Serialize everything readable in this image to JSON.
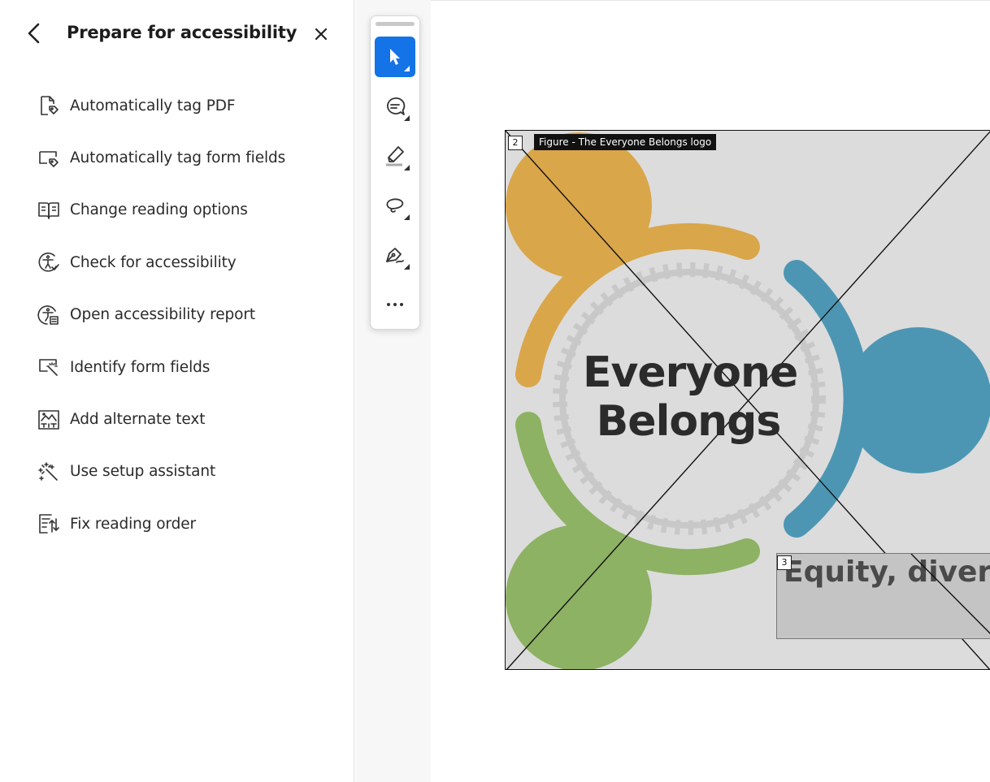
{
  "panel": {
    "title": "Prepare for accessibility",
    "tools": [
      {
        "label": "Automatically tag PDF",
        "icon": "tag-pdf-icon"
      },
      {
        "label": "Automatically tag form fields",
        "icon": "tag-form-fields-icon"
      },
      {
        "label": "Change reading options",
        "icon": "book-icon"
      },
      {
        "label": "Check for accessibility",
        "icon": "accessibility-check-icon"
      },
      {
        "label": "Open accessibility report",
        "icon": "accessibility-report-icon"
      },
      {
        "label": "Identify form fields",
        "icon": "identify-form-fields-icon"
      },
      {
        "label": "Add alternate text",
        "icon": "alt-text-icon"
      },
      {
        "label": "Use setup assistant",
        "icon": "magic-wand-icon"
      },
      {
        "label": "Fix reading order",
        "icon": "reading-order-icon"
      }
    ]
  },
  "toolbar": {
    "tools": [
      {
        "name": "select",
        "icon": "pointer-icon",
        "active": true
      },
      {
        "name": "comment",
        "icon": "comment-icon",
        "active": false
      },
      {
        "name": "highlight",
        "icon": "highlighter-icon",
        "active": false
      },
      {
        "name": "draw",
        "icon": "lasso-icon",
        "active": false
      },
      {
        "name": "sign",
        "icon": "pen-sign-icon",
        "active": false
      },
      {
        "name": "more",
        "icon": "more-icon",
        "active": false
      }
    ],
    "accent_color": "#1473e6"
  },
  "document": {
    "figure_tag_number": "2",
    "figure_label": "Figure - The Everyone Belongs logo",
    "logo_line1": "Everyone",
    "logo_line2": "Belongs",
    "text_tag_number": "3",
    "text_block": "Equity, diversity",
    "colors": {
      "yellow": "#d9a64a",
      "blue": "#4d96b3",
      "green": "#8db263",
      "track": "#c8c8c8"
    }
  }
}
